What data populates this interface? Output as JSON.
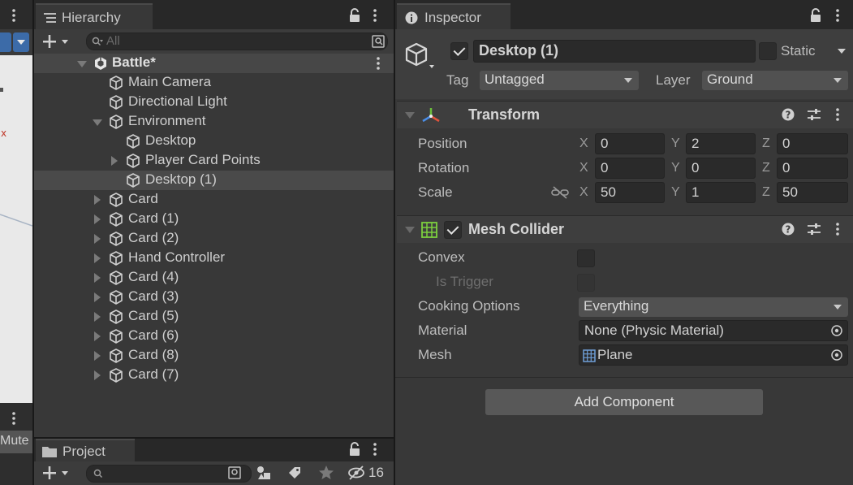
{
  "scene_strip": {
    "mute_label": "Mute"
  },
  "hierarchy": {
    "tab_title": "Hierarchy",
    "search_placeholder": "All",
    "scene_name": "Battle*",
    "items": [
      {
        "label": "Main Camera",
        "depth": 1,
        "expand": "none",
        "selected": false
      },
      {
        "label": "Directional Light",
        "depth": 1,
        "expand": "none",
        "selected": false
      },
      {
        "label": "Environment",
        "depth": 1,
        "expand": "open",
        "selected": false
      },
      {
        "label": "Desktop",
        "depth": 2,
        "expand": "none",
        "selected": false
      },
      {
        "label": "Player Card Points",
        "depth": 2,
        "expand": "closed",
        "selected": false
      },
      {
        "label": "Desktop (1)",
        "depth": 2,
        "expand": "none",
        "selected": true
      },
      {
        "label": "Card",
        "depth": 1,
        "expand": "closed",
        "selected": false
      },
      {
        "label": "Card (1)",
        "depth": 1,
        "expand": "closed",
        "selected": false
      },
      {
        "label": "Card (2)",
        "depth": 1,
        "expand": "closed",
        "selected": false
      },
      {
        "label": "Hand Controller",
        "depth": 1,
        "expand": "closed",
        "selected": false
      },
      {
        "label": "Card (4)",
        "depth": 1,
        "expand": "closed",
        "selected": false
      },
      {
        "label": "Card (3)",
        "depth": 1,
        "expand": "closed",
        "selected": false
      },
      {
        "label": "Card (5)",
        "depth": 1,
        "expand": "closed",
        "selected": false
      },
      {
        "label": "Card (6)",
        "depth": 1,
        "expand": "closed",
        "selected": false
      },
      {
        "label": "Card (8)",
        "depth": 1,
        "expand": "closed",
        "selected": false
      },
      {
        "label": "Card (7)",
        "depth": 1,
        "expand": "closed",
        "selected": false
      }
    ]
  },
  "project": {
    "tab_title": "Project",
    "hidden_count": "16"
  },
  "inspector": {
    "tab_title": "Inspector",
    "object_name": "Desktop (1)",
    "active": true,
    "static_label": "Static",
    "tag_label": "Tag",
    "tag_value": "Untagged",
    "layer_label": "Layer",
    "layer_value": "Ground",
    "transform": {
      "title": "Transform",
      "axis_x": "X",
      "axis_y": "Y",
      "axis_z": "Z",
      "position": {
        "label": "Position",
        "x": "0",
        "y": "2",
        "z": "0"
      },
      "rotation": {
        "label": "Rotation",
        "x": "0",
        "y": "0",
        "z": "0"
      },
      "scale": {
        "label": "Scale",
        "x": "50",
        "y": "1",
        "z": "50"
      }
    },
    "mesh_collider": {
      "title": "Mesh Collider",
      "enabled": true,
      "convex_label": "Convex",
      "is_trigger_label": "Is Trigger",
      "cooking_label": "Cooking Options",
      "cooking_value": "Everything",
      "material_label": "Material",
      "material_value": "None (Physic Material)",
      "mesh_label": "Mesh",
      "mesh_value": "Plane"
    },
    "add_component_label": "Add Component"
  },
  "colors": {
    "panel": "#383838",
    "header": "#3e3e3e",
    "selected_row": "#4a4a4a",
    "field": "#2a2a2a"
  }
}
